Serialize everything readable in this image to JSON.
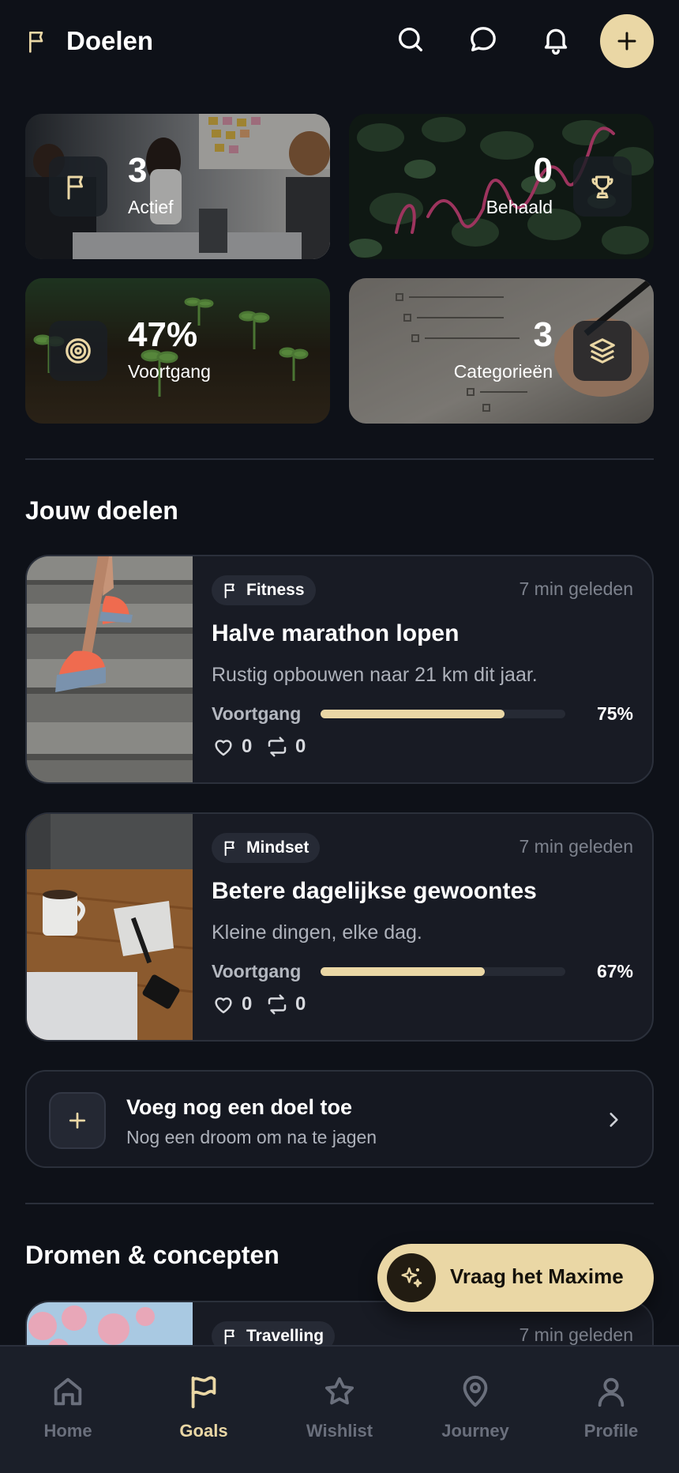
{
  "header": {
    "title": "Doelen"
  },
  "stats": [
    {
      "value": "3",
      "label": "Actief",
      "icon": "flag-icon"
    },
    {
      "value": "0",
      "label": "Behaald",
      "icon": "trophy-icon"
    },
    {
      "value": "47%",
      "label": "Voortgang",
      "icon": "target-icon"
    },
    {
      "value": "3",
      "label": "Categorieën",
      "icon": "layers-icon"
    }
  ],
  "goals_section": {
    "title": "Jouw doelen"
  },
  "goals": [
    {
      "category": "Fitness",
      "time": "7 min geleden",
      "title": "Halve marathon lopen",
      "description": "Rustig opbouwen naar 21 km dit jaar.",
      "progress_label": "Voortgang",
      "progress": 0.75,
      "progress_text": "75%",
      "likes": "0",
      "reposts": "0"
    },
    {
      "category": "Mindset",
      "time": "7 min geleden",
      "title": "Betere dagelijkse gewoontes",
      "description": "Kleine dingen, elke dag.",
      "progress_label": "Voortgang",
      "progress": 0.67,
      "progress_text": "67%",
      "likes": "0",
      "reposts": "0"
    }
  ],
  "add_goal": {
    "title": "Voeg nog een doel toe",
    "subtitle": "Nog een droom om na te jagen"
  },
  "dreams_section": {
    "title": "Dromen & concepten"
  },
  "dreams": [
    {
      "category": "Travelling",
      "time": "7 min geleden"
    }
  ],
  "fab": {
    "label": "Vraag het Maxime"
  },
  "nav": [
    {
      "label": "Home",
      "icon": "home-icon"
    },
    {
      "label": "Goals",
      "icon": "flag-icon",
      "active": true
    },
    {
      "label": "Wishlist",
      "icon": "star-icon"
    },
    {
      "label": "Journey",
      "icon": "map-pin-icon"
    },
    {
      "label": "Profile",
      "icon": "user-icon"
    }
  ],
  "colors": {
    "background": "#0e1118",
    "accent": "#ead7a5",
    "card": "#181b24",
    "muted": "#7d828d"
  }
}
